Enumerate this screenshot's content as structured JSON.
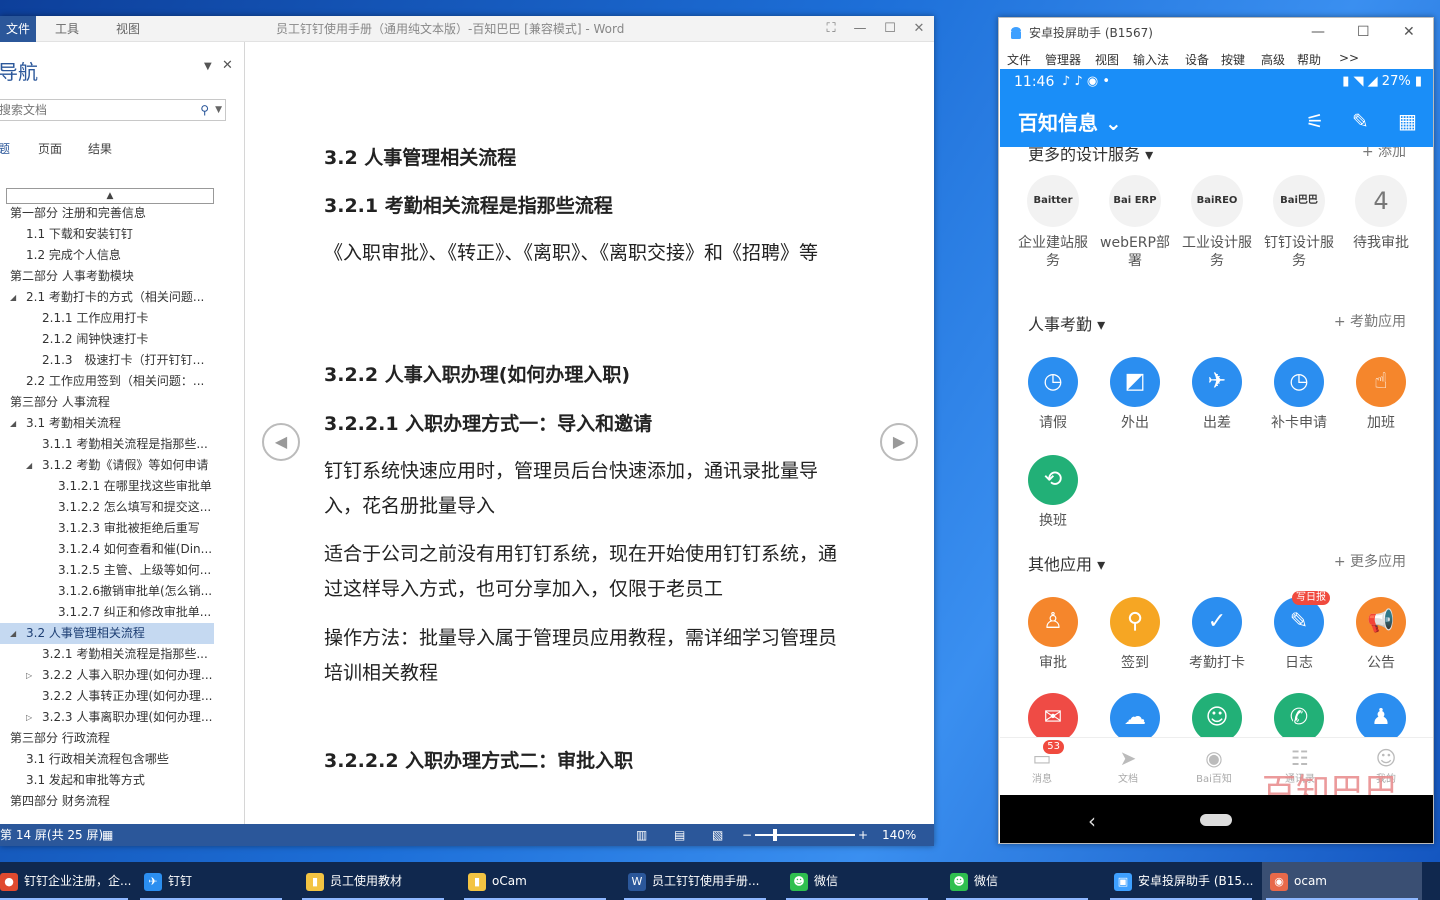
{
  "word": {
    "tabs": [
      "文件",
      "工具",
      "视图"
    ],
    "title": "员工钉钉使用手册（通用纯文本版）-百知巴巴 [兼容模式] - Word",
    "nav": {
      "heading": "导航",
      "search_placeholder": "搜索文档",
      "tabs": [
        "标题",
        "页面",
        "结果"
      ],
      "items": [
        {
          "text": "第一部分 注册和完善信息",
          "level": 0
        },
        {
          "text": "1.1 下载和安装钉钉",
          "level": 1
        },
        {
          "text": "1.2 完成个人信息",
          "level": 1
        },
        {
          "text": "第二部分 人事考勤模块",
          "level": 0
        },
        {
          "text": "2.1 考勤打卡的方式（相关问题...",
          "level": 1,
          "expander": "open"
        },
        {
          "text": "2.1.1 工作应用打卡",
          "level": 2
        },
        {
          "text": "2.1.2 闹钟快速打卡",
          "level": 2
        },
        {
          "text": "2.1.3　极速打卡（打开钉钉自...",
          "level": 2
        },
        {
          "text": "2.2 工作应用签到（相关问题：...",
          "level": 1
        },
        {
          "text": "第三部分 人事流程",
          "level": 0
        },
        {
          "text": "3.1 考勤相关流程",
          "level": 1,
          "expander": "open"
        },
        {
          "text": "3.1.1 考勤相关流程是指那些...",
          "level": 2
        },
        {
          "text": "3.1.2 考勤《请假》等如何申请",
          "level": 2,
          "expander": "open"
        },
        {
          "text": "3.1.2.1 在哪里找这些审批单",
          "level": 3
        },
        {
          "text": "3.1.2.2 怎么填写和提交这...",
          "level": 3
        },
        {
          "text": "3.1.2.3 审批被拒绝后重写",
          "level": 3
        },
        {
          "text": "3.1.2.4 如何查看和催(Din...",
          "level": 3
        },
        {
          "text": "3.1.2.5 主管、上级等如何...",
          "level": 3
        },
        {
          "text": "3.1.2.6撤销审批单(怎么销...",
          "level": 3
        },
        {
          "text": "3.1.2.7 纠正和修改审批单...",
          "level": 3
        },
        {
          "text": "3.2 人事管理相关流程",
          "level": 1,
          "expander": "open",
          "selected": true
        },
        {
          "text": "3.2.1 考勤相关流程是指那些...",
          "level": 2
        },
        {
          "text": "3.2.2 人事入职办理(如何办理...",
          "level": 2,
          "expander": "closed"
        },
        {
          "text": "3.2.2 人事转正办理(如何办理...",
          "level": 2
        },
        {
          "text": "3.2.3 人事离职办理(如何办理...",
          "level": 2,
          "expander": "closed"
        },
        {
          "text": "第三部分 行政流程",
          "level": 0
        },
        {
          "text": "3.1 行政相关流程包含哪些",
          "level": 1
        },
        {
          "text": "3.1 发起和审批等方式",
          "level": 1
        },
        {
          "text": "第四部分 财务流程",
          "level": 0
        }
      ]
    },
    "doc": {
      "h_32": "3.2 人事管理相关流程",
      "h_321": "3.2.1 考勤相关流程是指那些流程",
      "p1": "《入职审批》、《转正》、《离职》、《离职交接》和《招聘》等",
      "h_322": "3.2.2 人事入职办理(如何办理入职)",
      "h_3221": "3.2.2.1 入职办理方式一：导入和邀请",
      "p2": "钉钉系统快速应用时，管理员后台快速添加，通讯录批量导入，花名册批量导入",
      "p3": "适合于公司之前没有用钉钉系统，现在开始使用钉钉系统，通过这样导入方式，也可分享加入，仅限于老员工",
      "p4": "操作方法：批量导入属于管理员应用教程，需详细学习管理员培训相关教程",
      "h_3222": "3.2.2.2 入职办理方式二：审批入职"
    },
    "status": {
      "page": "第 14 屏(共 25 屏)",
      "zoom": "140%"
    }
  },
  "android": {
    "title": "安卓投屏助手 (B1567)",
    "menu": [
      "文件",
      "管理器",
      "视图",
      "输入法",
      "设备",
      "按键",
      "高级",
      "帮助",
      ">>"
    ],
    "status_time": "11:46",
    "battery": "27%",
    "org": "百知信息",
    "more_services": "更多的设计服务",
    "add": "+ 添加",
    "services": [
      {
        "logo": "Baitter",
        "label": "企业建站服务"
      },
      {
        "logo": "Bai ERP",
        "label": "webERP部署"
      },
      {
        "logo": "BaiREO",
        "label": "工业设计服务"
      },
      {
        "logo": "Bai巴巴",
        "label": "钉钉设计服务"
      },
      {
        "logo": "4",
        "label": "待我审批"
      }
    ],
    "hr_section": "人事考勤",
    "hr_link": "+ 考勤应用",
    "hr_apps": [
      {
        "label": "请假",
        "color": "#2b8ef0",
        "icon": "clock-icon"
      },
      {
        "label": "外出",
        "color": "#2b8ef0",
        "icon": "eraser-icon"
      },
      {
        "label": "出差",
        "color": "#2b8ef0",
        "icon": "plane-icon"
      },
      {
        "label": "补卡申请",
        "color": "#2b8ef0",
        "icon": "clock-icon"
      },
      {
        "label": "加班",
        "color": "#f5862c",
        "icon": "hand-icon"
      },
      {
        "label": "换班",
        "color": "#22b077",
        "icon": "swap-icon"
      }
    ],
    "other_section": "其他应用",
    "other_link": "+ 更多应用",
    "other_apps": [
      {
        "label": "审批",
        "color": "#f5862c",
        "icon": "stamp-icon"
      },
      {
        "label": "签到",
        "color": "#f6a623",
        "icon": "pin-icon"
      },
      {
        "label": "考勤打卡",
        "color": "#2b8ef0",
        "icon": "check-pin-icon"
      },
      {
        "label": "日志",
        "color": "#2b8ef0",
        "icon": "notebook-icon",
        "badge": "写日报"
      },
      {
        "label": "公告",
        "color": "#f5862c",
        "icon": "megaphone-icon"
      }
    ],
    "row3_colors": [
      "#ef4b45",
      "#2b8ef0",
      "#22b077",
      "#22b077",
      "#2b8ef0"
    ],
    "tabs": [
      {
        "label": "消息",
        "badge": "53"
      },
      {
        "label": "文档"
      },
      {
        "label": "Bai百知"
      },
      {
        "label": "通讯录"
      },
      {
        "label": "我的"
      }
    ],
    "watermark": "百知巴巴"
  },
  "taskbar": [
    {
      "label": "钉钉企业注册，企...",
      "color": "#e04a2f",
      "active": false
    },
    {
      "label": "钉钉",
      "color": "#2b8ef0",
      "active": false
    },
    {
      "label": "员工使用教材",
      "color": "#f3c443",
      "active": false
    },
    {
      "label": "oCam",
      "color": "#f3c443",
      "active": false
    },
    {
      "label": "员工钉钉使用手册...",
      "color": "#2b579a",
      "active": false
    },
    {
      "label": "微信",
      "color": "#2fbf4f",
      "active": false
    },
    {
      "label": "微信",
      "color": "#2fbf4f",
      "active": false
    },
    {
      "label": "安卓投屏助手 (B15...",
      "color": "#3ea0ff",
      "active": false
    },
    {
      "label": "ocam",
      "color": "#e8694a",
      "active": true
    }
  ]
}
